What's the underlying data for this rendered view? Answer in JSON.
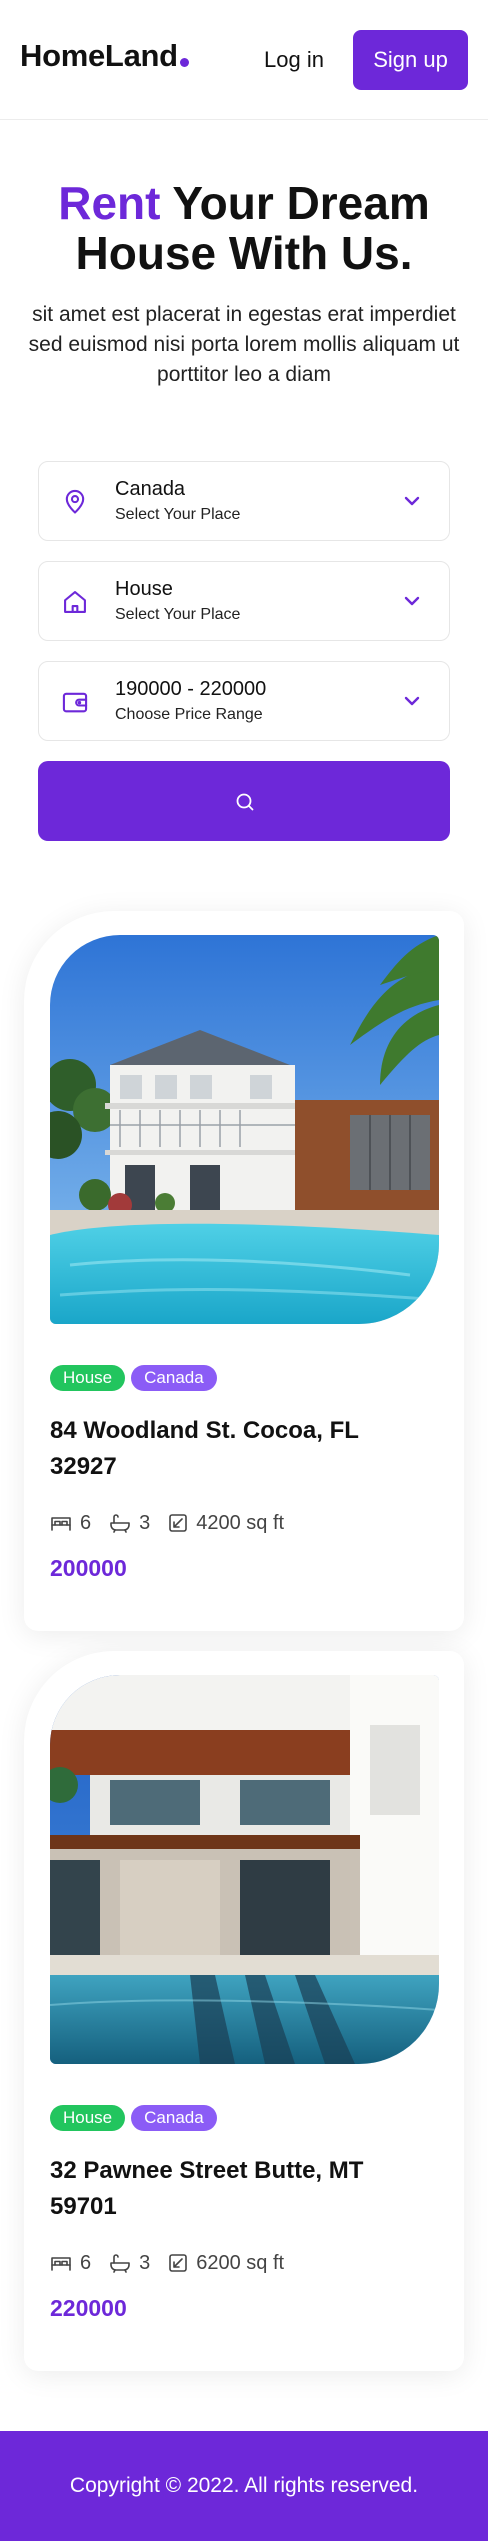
{
  "header": {
    "logo_text": "HomeLand",
    "login_label": "Log in",
    "signup_label": "Sign up"
  },
  "hero": {
    "title_accent": "Rent",
    "title_line1_rest": " Your Dream",
    "title_line2": "House With Us.",
    "description": "sit amet est placerat in egestas erat imperdiet sed euismod nisi porta lorem mollis aliquam ut porttitor leo a diam"
  },
  "filters": [
    {
      "icon": "location-pin-icon",
      "value": "Canada",
      "label": "Select Your Place"
    },
    {
      "icon": "house-icon",
      "value": "House",
      "label": "Select Your Place"
    },
    {
      "icon": "wallet-icon",
      "value": "190000 - 220000",
      "label": "Choose Price Range"
    }
  ],
  "search": {
    "icon": "search-icon"
  },
  "listings": [
    {
      "type_tag": "House",
      "location_tag": "Canada",
      "address": "84 Woodland St. Cocoa, FL 32927",
      "beds": "6",
      "baths": "3",
      "area": "4200 sq ft",
      "price": "200000"
    },
    {
      "type_tag": "House",
      "location_tag": "Canada",
      "address": "32 Pawnee Street Butte, MT 59701",
      "beds": "6",
      "baths": "3",
      "area": "6200 sq ft",
      "price": "220000"
    }
  ],
  "footer": {
    "copyright": "Copyright © 2022. All rights reserved."
  },
  "colors": {
    "accent": "#6d28d9",
    "tag_green": "#22c55e",
    "tag_purple": "#8b5cf6"
  }
}
